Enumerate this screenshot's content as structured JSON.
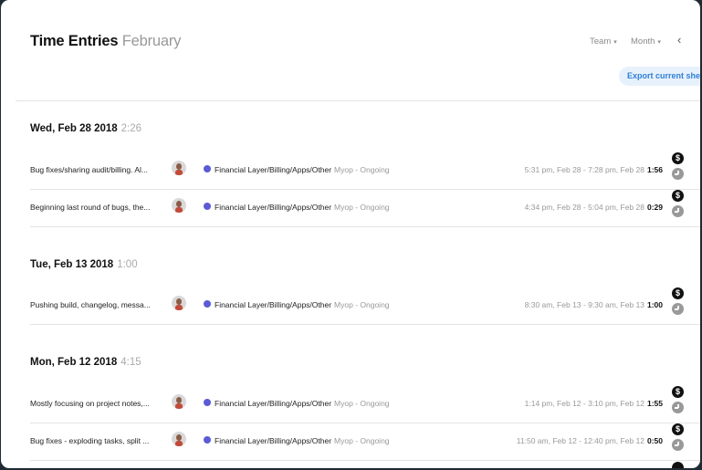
{
  "header": {
    "title": "Time Entries",
    "subtitle": "February",
    "team_label": "Team",
    "month_label": "Month",
    "back_glyph": "‹",
    "export_label": "Export current sheet"
  },
  "colors": {
    "project_dot": "#5b5bd6",
    "export_bg": "#e7f1fc",
    "export_text": "#2f7fd8"
  },
  "icons": {
    "billable": "dollar-icon",
    "clock": "clock-icon",
    "caret": "caret-down-icon",
    "back": "chevron-left-icon"
  },
  "days": [
    {
      "date": "Wed, Feb 28 2018",
      "total": "2:26",
      "entries": [
        {
          "description": "Bug fixes/sharing audit/billing. Al...",
          "project": "Financial Layer/Billing/Apps/Other",
          "client": "Myop - Ongoing",
          "range": "5:31 pm, Feb 28 - 7:28 pm, Feb 28",
          "duration": "1:56"
        },
        {
          "description": "Beginning last round of bugs, the...",
          "project": "Financial Layer/Billing/Apps/Other",
          "client": "Myop - Ongoing",
          "range": "4:34 pm, Feb 28 - 5:04 pm, Feb 28",
          "duration": "0:29"
        }
      ]
    },
    {
      "date": "Tue, Feb 13 2018",
      "total": "1:00",
      "entries": [
        {
          "description": "Pushing build, changelog, messa...",
          "project": "Financial Layer/Billing/Apps/Other",
          "client": "Myop - Ongoing",
          "range": "8:30 am, Feb 13 - 9:30 am, Feb 13",
          "duration": "1:00"
        }
      ]
    },
    {
      "date": "Mon, Feb 12 2018",
      "total": "4:15",
      "entries": [
        {
          "description": "Mostly focusing on project notes,...",
          "project": "Financial Layer/Billing/Apps/Other",
          "client": "Myop - Ongoing",
          "range": "1:14 pm, Feb 12 - 3:10 pm, Feb 12",
          "duration": "1:55"
        },
        {
          "description": "Bug fixes - exploding tasks, split ...",
          "project": "Financial Layer/Billing/Apps/Other",
          "client": "Myop - Ongoing",
          "range": "11:50 am, Feb 12 - 12:40 pm, Feb 12",
          "duration": "0:50"
        }
      ]
    }
  ]
}
